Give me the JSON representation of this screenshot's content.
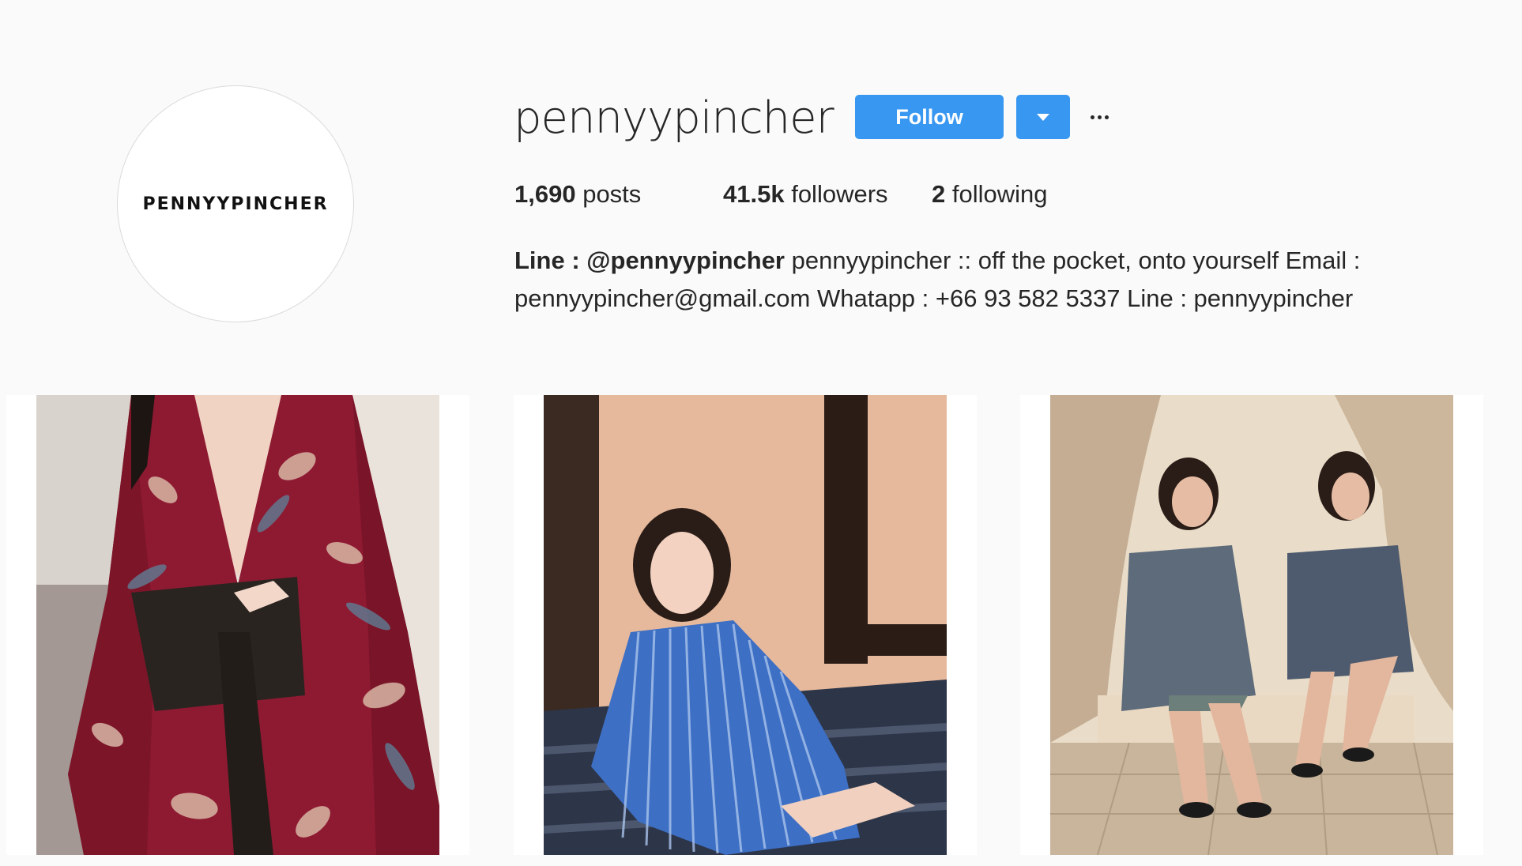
{
  "profile": {
    "avatar_logo_text": "PENNYYPINCHER",
    "username": "pennyypincher",
    "follow_label": "Follow",
    "dropdown_icon": "caret-down-icon",
    "more_icon": "more-horizontal-icon",
    "accent_color": "#3897f0"
  },
  "stats": {
    "posts_count": "1,690",
    "posts_label": "posts",
    "followers_count": "41.5k",
    "followers_label": "followers",
    "following_count": "2",
    "following_label": "following"
  },
  "bio": {
    "bold_part": "Line : @pennyypincher",
    "text_line1": "pennyypincher :: off the pocket, onto yourself Email :",
    "text_line2": "pennyypincher@gmail.com Whatapp : +66 93 582 5337 Line : pennyypincher"
  },
  "posts": [
    {
      "subject": "woman in red floral kimono robe with black obi belt"
    },
    {
      "subject": "woman in blue striped off-shoulder shirt dress on striped sofa"
    },
    {
      "subject": "two women in striped shirt dresses sitting in beige alcove"
    }
  ]
}
